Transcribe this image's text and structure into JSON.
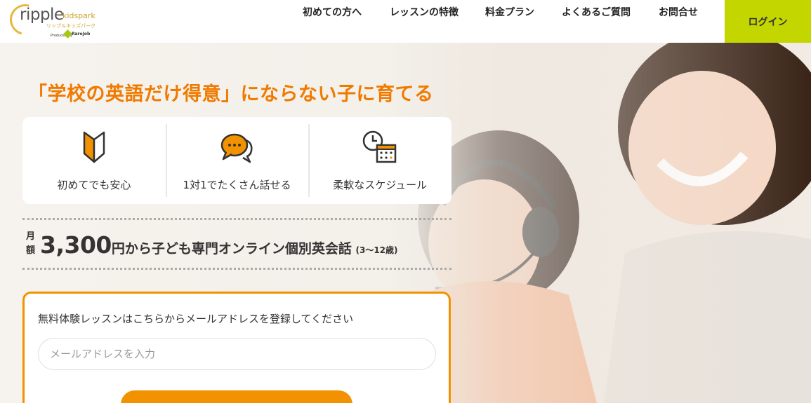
{
  "header": {
    "logo": {
      "main": "ripple",
      "sub": "kidspark",
      "kana": "リップルキッズパーク",
      "by": "Produced by",
      "company": "RareJob"
    },
    "nav": [
      {
        "label": "初めての方へ"
      },
      {
        "label": "レッスンの特徴"
      },
      {
        "label": "料金プラン"
      },
      {
        "label": "よくあるご質問"
      },
      {
        "label": "お問合せ"
      }
    ],
    "login_label": "ログイン"
  },
  "hero": {
    "headline": "「学校の英語だけ得意」にならない子に育てる",
    "features": [
      {
        "label": "初めてでも安心",
        "icon": "beginner-mark-icon"
      },
      {
        "label": "1対1でたくさん話せる",
        "icon": "chat-bubbles-icon"
      },
      {
        "label": "柔軟なスケジュール",
        "icon": "clock-calendar-icon"
      }
    ],
    "price": {
      "month_label": "月額",
      "amount": "3,300",
      "yen": "円",
      "text": "から子ども専門オンライン個別英会話",
      "age": "(3〜12歳)"
    }
  },
  "form": {
    "title": "無料体験レッスンはこちらからメールアドレスを登録してください",
    "email_placeholder": "メールアドレスを入力"
  },
  "colors": {
    "accent": "#f39200",
    "headline": "#f07a00",
    "login": "#c3d600"
  }
}
